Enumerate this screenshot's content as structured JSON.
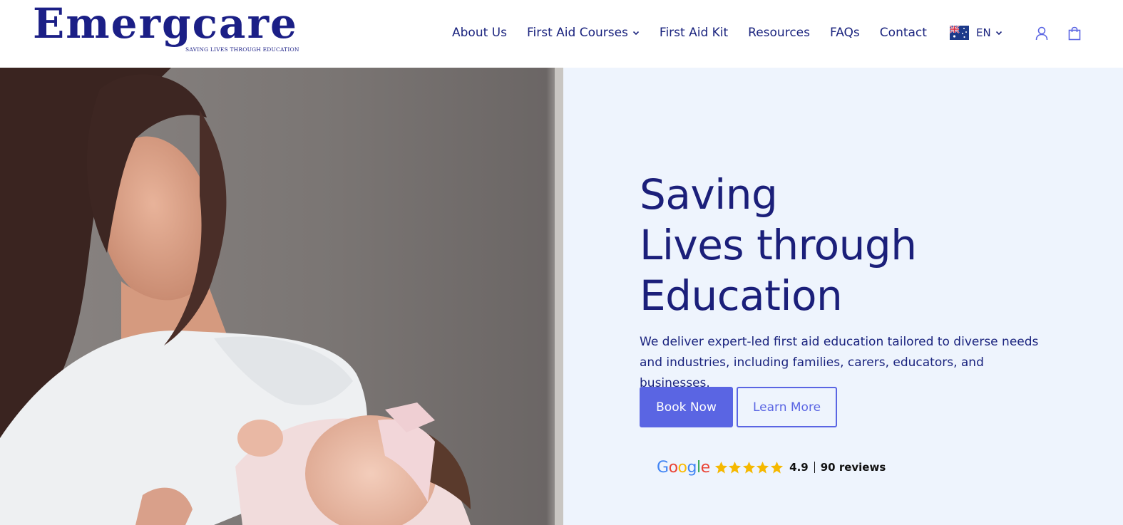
{
  "brand": {
    "name": "Emergcare",
    "tagline": "SAVING LIVES THROUGH EDUCATION",
    "color": "#1b1f86"
  },
  "nav": {
    "items": [
      {
        "label": "About Us",
        "has_dropdown": false
      },
      {
        "label": "First Aid Courses",
        "has_dropdown": true
      },
      {
        "label": "First Aid Kit",
        "has_dropdown": false
      },
      {
        "label": "Resources",
        "has_dropdown": false
      },
      {
        "label": "FAQs",
        "has_dropdown": false
      },
      {
        "label": "Contact",
        "has_dropdown": false
      }
    ],
    "language": {
      "label": "EN",
      "flag": "australia-flag-icon"
    },
    "icons": [
      "user-icon",
      "shopping-bag-icon"
    ]
  },
  "hero": {
    "image": "mother-holding-newborn-photo",
    "title_lines": [
      "Saving",
      "Lives through",
      "Education"
    ],
    "subtitle": "We deliver expert-led first aid education tailored to diverse needs and industries, including families, carers, educators, and businesses.",
    "primary_button": "Book Now",
    "secondary_button": "Learn More",
    "background": "#eef4fd",
    "accent": "#5a65e3"
  },
  "rating": {
    "provider": "Google",
    "stars": 5,
    "score": "4.9",
    "reviews": "90 reviews",
    "star_color": "#f5b800"
  }
}
